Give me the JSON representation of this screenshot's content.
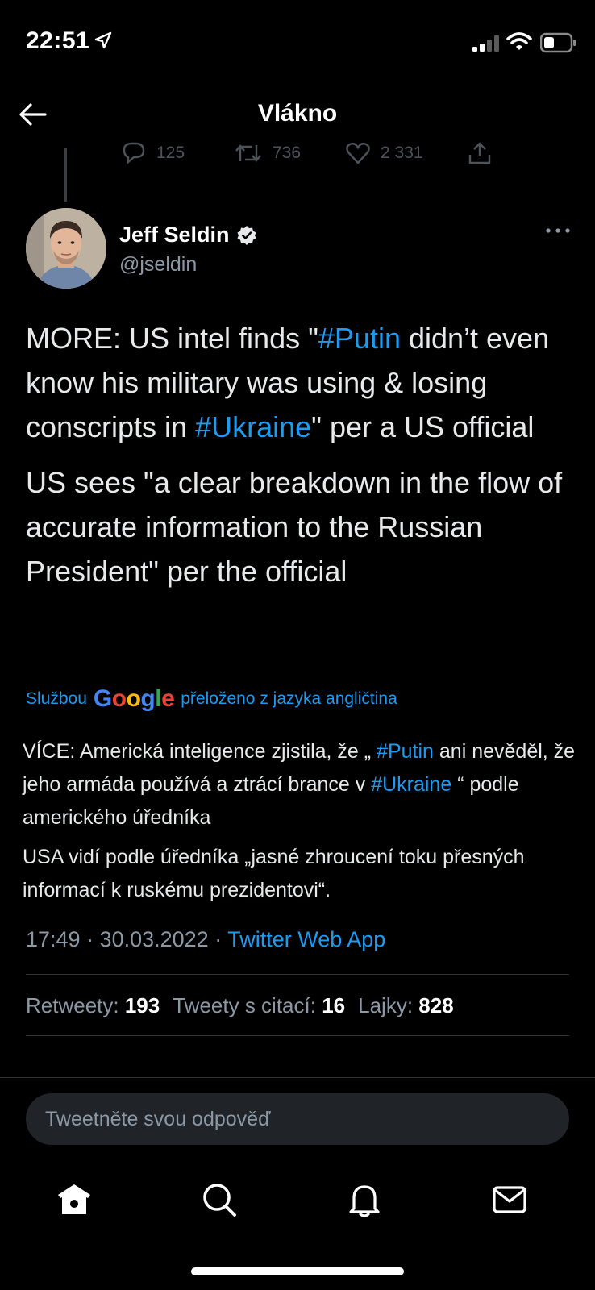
{
  "status_bar": {
    "time": "22:51",
    "icons": [
      "location-arrow-icon",
      "cellular-signal-icon",
      "wifi-icon",
      "battery-icon"
    ]
  },
  "header": {
    "title": "Vlákno",
    "back_icon": "arrow-left-icon"
  },
  "previous_tweet_actions": {
    "replies": "125",
    "retweets": "736",
    "likes": "2 331"
  },
  "tweet": {
    "author": {
      "name": "Jeff Seldin",
      "handle": "@jseldin",
      "verified": true
    },
    "paragraph1": {
      "part1": "MORE: US intel finds \"",
      "hashtag1": "#Putin",
      "part2": " didn’t even know his military was using & losing conscripts in ",
      "hashtag2": "#Ukraine",
      "part3": "\" per a US official"
    },
    "paragraph2": "US sees \"a clear breakdown in the flow of accurate information to the Russian President\" per the official",
    "translation_label": {
      "prefix": "Službou",
      "brand": "Google",
      "suffix": "přeloženo z jazyka angličtina"
    },
    "translation": {
      "part1": "VÍCE: Americká inteligence zjistila, že „ ",
      "hashtag1": "#Putin",
      "part2": " ani nevěděl, že jeho armáda používá a ztrácí brance v ",
      "hashtag2": "#Ukraine",
      "part3": " “ podle amerického úředníka",
      "paragraph2": " USA vidí podle úředníka „jasné zhroucení toku přesných informací k ruskému prezidentovi“."
    },
    "meta": {
      "timestamp": "17:49 · 30.03.2022 · ",
      "source": "Twitter Web App"
    },
    "stats": {
      "retweets_label": "Retweety:",
      "retweets": "193",
      "quotes_label": "Tweety s citací:",
      "quotes": "16",
      "likes_label": "Lajky:",
      "likes": "828"
    }
  },
  "reply": {
    "placeholder": "Tweetněte svou odpověď"
  },
  "tabbar": {
    "tabs": [
      "home-icon",
      "search-icon",
      "notifications-icon",
      "messages-icon"
    ]
  },
  "colors": {
    "background": "#000000",
    "accent": "#1d9bf0",
    "secondary_text": "#8b98a5"
  }
}
